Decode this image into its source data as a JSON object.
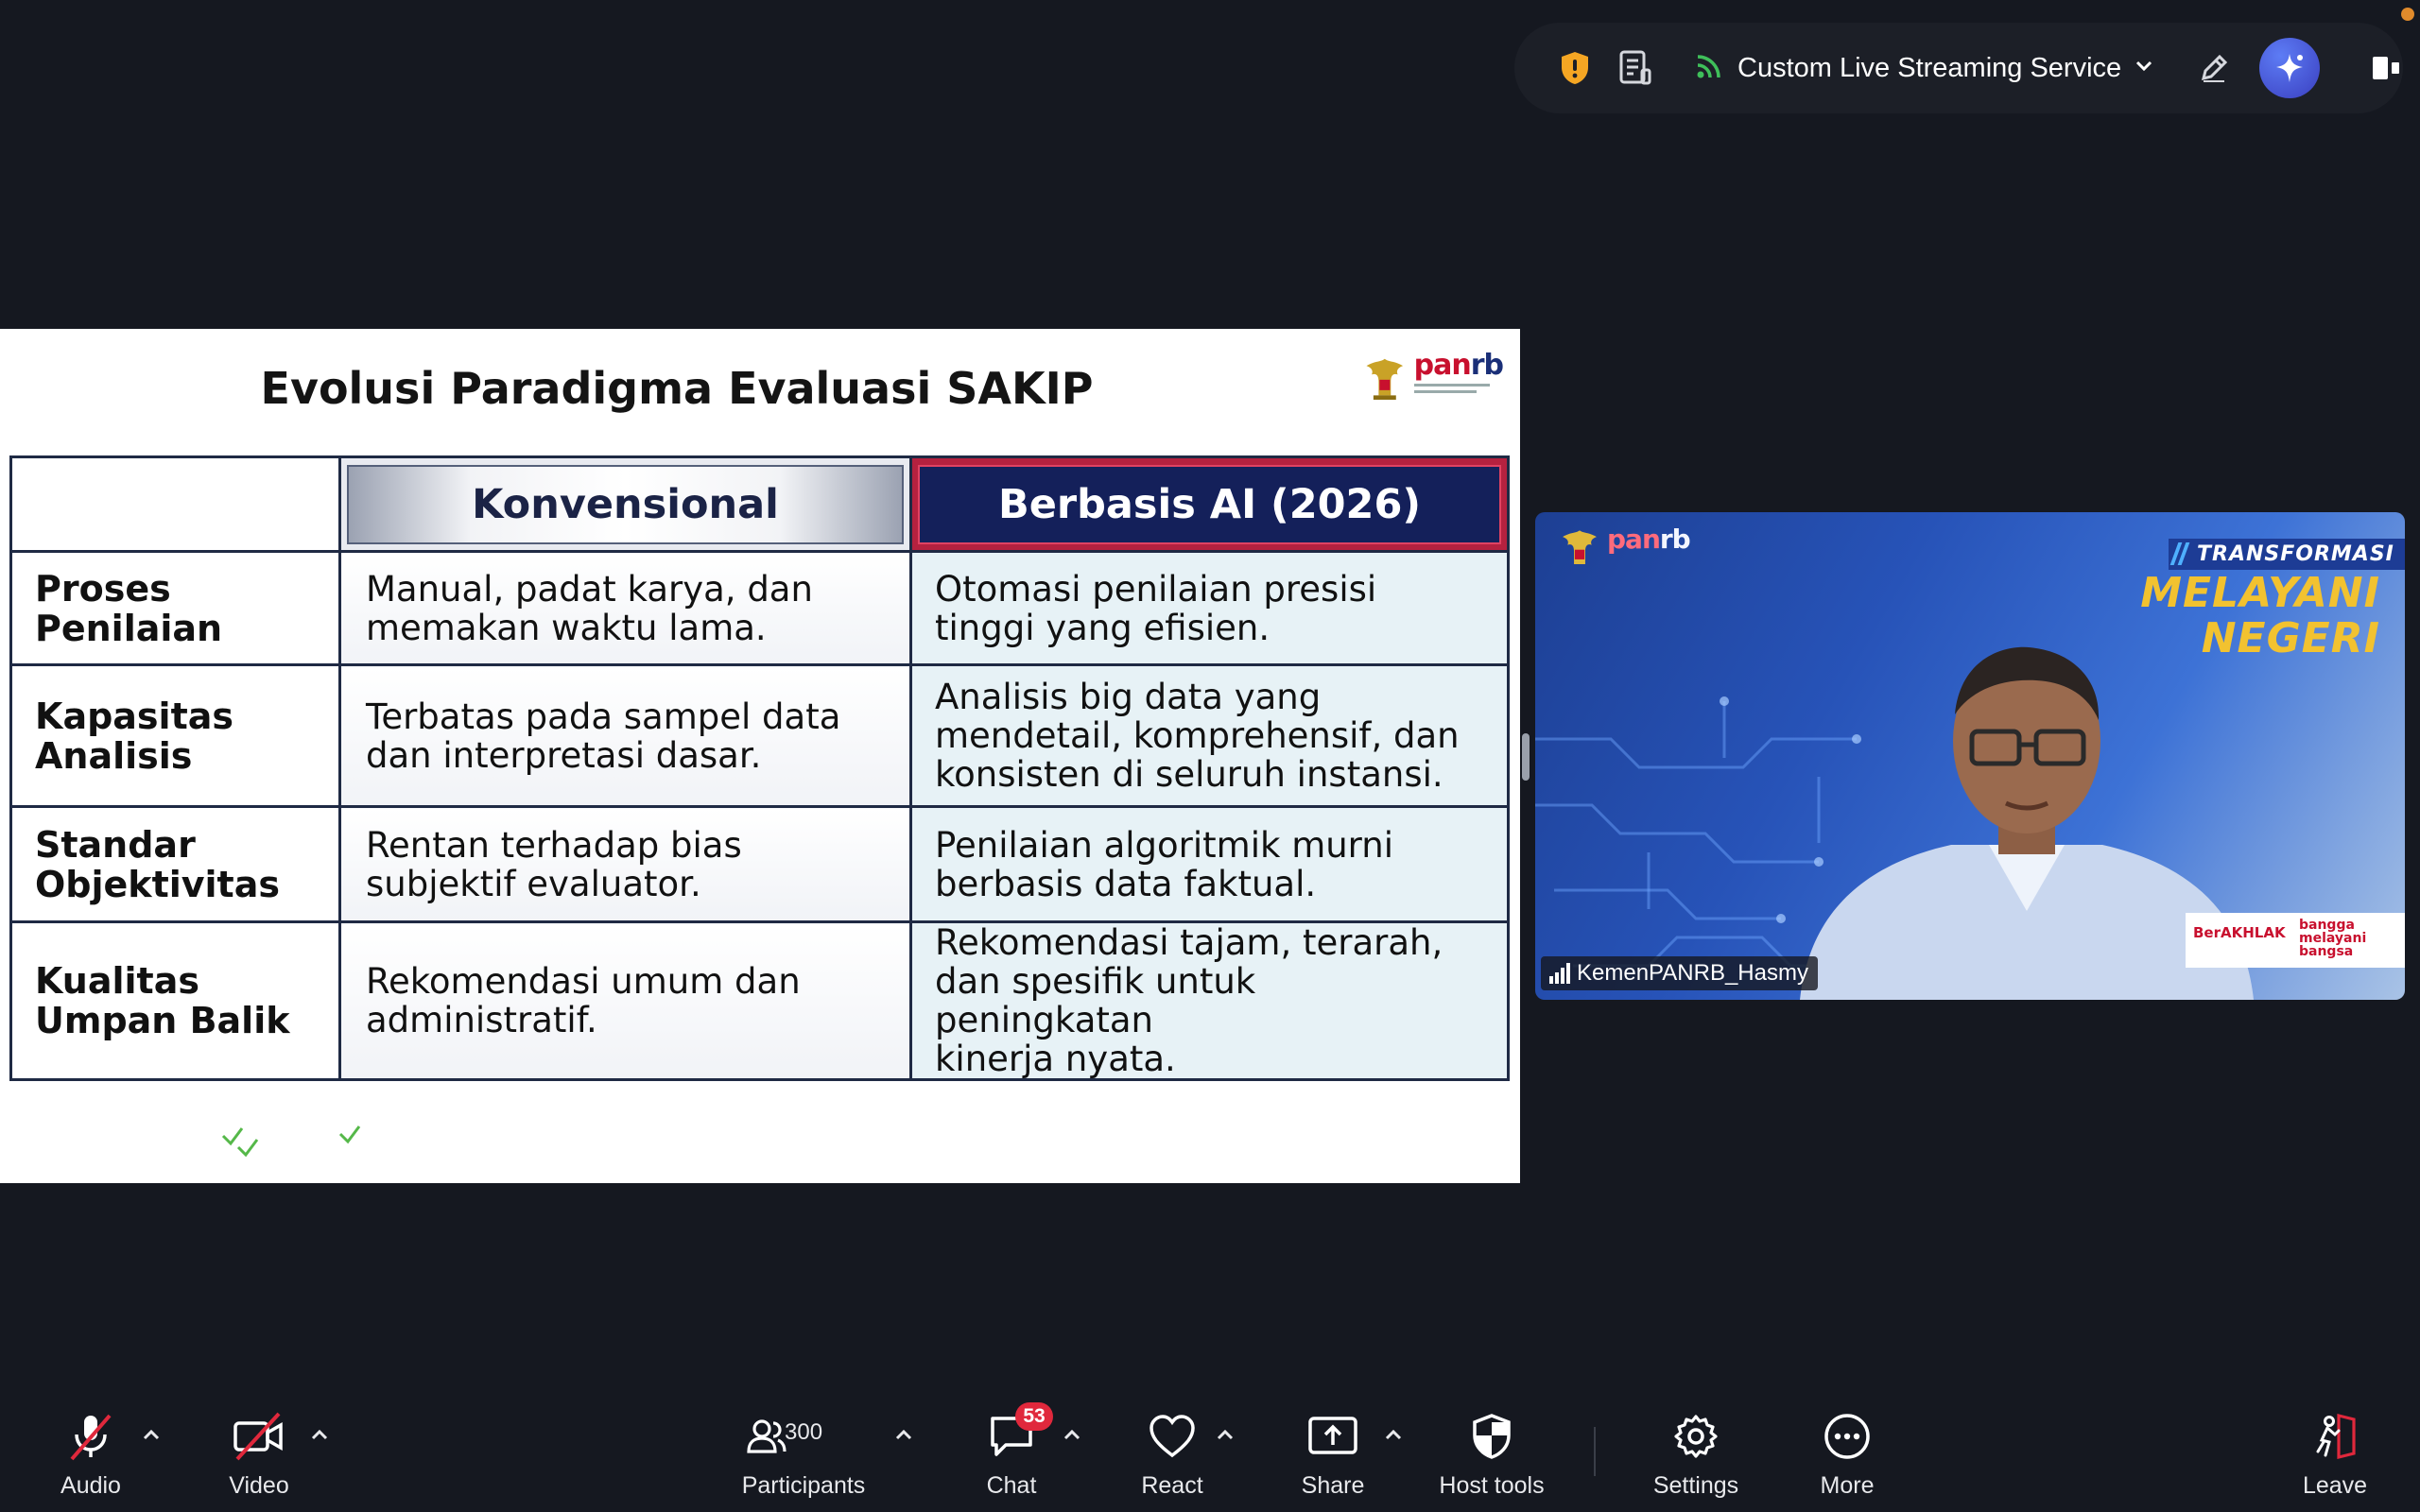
{
  "topbar": {
    "stream_label": "Custom Live Streaming Service"
  },
  "slide": {
    "title": "Evolusi Paradigma Evaluasi SAKIP",
    "logo": {
      "pan": "pan",
      "rb": "rb"
    },
    "columns": [
      "Konvensional",
      "Berbasis AI (2026)"
    ],
    "rows": [
      {
        "label_line1": "Proses",
        "label_line2": "Penilaian",
        "konv_line1": "Manual, padat karya, dan",
        "konv_line2": "memakan waktu lama.",
        "ai_line1": "Otomasi penilaian presisi",
        "ai_line2": "tinggi yang efisien.",
        "ai_line3": ""
      },
      {
        "label_line1": "Kapasitas",
        "label_line2": "Analisis",
        "konv_line1": "Terbatas pada sampel data",
        "konv_line2": "dan interpretasi dasar.",
        "ai_line1": "Analisis big data yang",
        "ai_line2": "mendetail, komprehensif, dan",
        "ai_line3": "konsisten di seluruh instansi."
      },
      {
        "label_line1": "Standar",
        "label_line2": "Objektivitas",
        "konv_line1": "Rentan terhadap bias",
        "konv_line2": "subjektif evaluator.",
        "ai_line1": "Penilaian algoritmik murni",
        "ai_line2": "berbasis data faktual.",
        "ai_line3": ""
      },
      {
        "label_line1": "Kualitas",
        "label_line2": "Umpan Balik",
        "konv_line1": "Rekomendasi umum dan",
        "konv_line2": "administratif.",
        "ai_line1": "Rekomendasi tajam, terarah,",
        "ai_line2": "dan spesifik untuk peningkatan",
        "ai_line3": "kinerja nyata."
      }
    ]
  },
  "video": {
    "logo": {
      "pan": "pan",
      "rb": "rb"
    },
    "tag": "TRANSFORMASI",
    "headline_line1": "MELAYANI",
    "headline_line2": "NEGERI",
    "footer_left": "BerAKHLAK",
    "footer_right_1": "bangga",
    "footer_right_2": "melayani",
    "footer_right_3": "bangsa",
    "participant_name": "KemenPANRB_Hasmy"
  },
  "toolbar": {
    "audio_label": "Audio",
    "video_label": "Video",
    "participants_label": "Participants",
    "participants_count": "300",
    "chat_label": "Chat",
    "chat_badge": "53",
    "react_label": "React",
    "share_label": "Share",
    "host_tools_label": "Host tools",
    "settings_label": "Settings",
    "more_label": "More",
    "leave_label": "Leave"
  },
  "colors": {
    "background": "#151820",
    "accent_ai": "#5d7cf5",
    "muted_red": "#e0283c",
    "streaming_green": "#3fbf5a",
    "shield_orange": "#f5a623"
  }
}
